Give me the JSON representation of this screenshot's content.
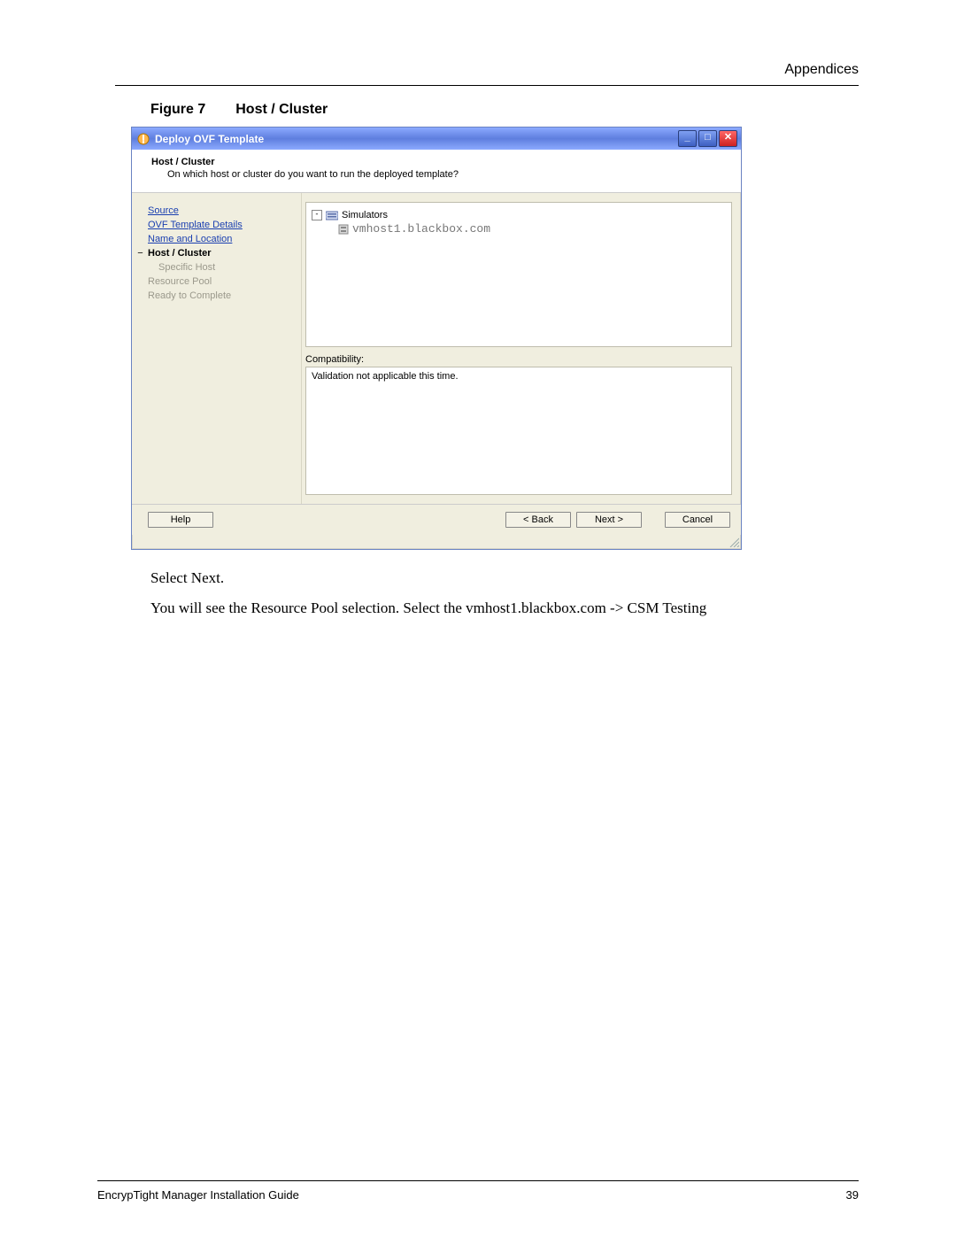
{
  "page": {
    "top_label": "Appendices",
    "footer_left": "EncrypTight Manager Installation Guide",
    "footer_right": "39"
  },
  "figure": {
    "label": "Figure 7",
    "title": "Host / Cluster"
  },
  "window": {
    "title": "Deploy OVF Template",
    "controls": {
      "min": "_",
      "max": "□",
      "close": "✕"
    },
    "header": {
      "title": "Host / Cluster",
      "subtitle": "On which host or cluster do you want to run the deployed template?"
    },
    "sidebar": {
      "items": [
        {
          "label": "Source",
          "state": "link"
        },
        {
          "label": "OVF Template Details",
          "state": "link"
        },
        {
          "label": "Name and Location",
          "state": "link"
        },
        {
          "label": "Host / Cluster",
          "state": "current"
        },
        {
          "label": "Specific Host",
          "state": "sub-disabled"
        },
        {
          "label": "Resource Pool",
          "state": "disabled"
        },
        {
          "label": "Ready to Complete",
          "state": "disabled"
        }
      ]
    },
    "tree": {
      "root": "Simulators",
      "host": "vmhost1.blackbox.com"
    },
    "compat": {
      "label": "Compatibility:",
      "text": "Validation not applicable this time."
    },
    "buttons": {
      "help": "Help",
      "back": "< Back",
      "next": "Next >",
      "cancel": "Cancel"
    }
  },
  "body": {
    "line1": "Select Next.",
    "line2": "You will see the Resource Pool selection. Select the vmhost1.blackbox.com -> CSM Testing"
  }
}
